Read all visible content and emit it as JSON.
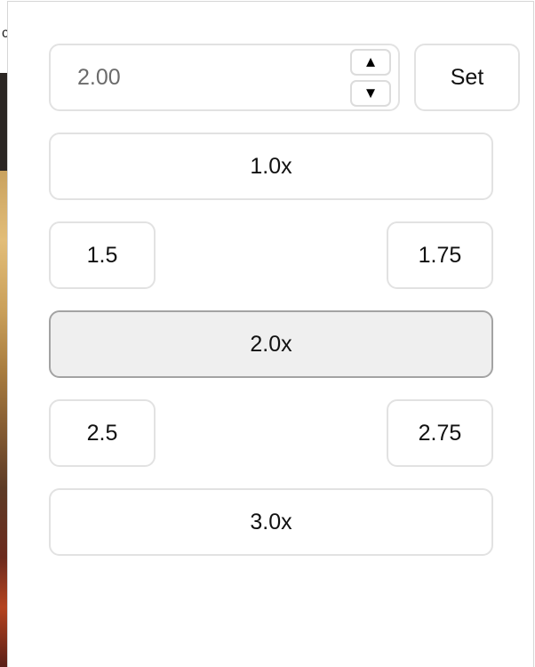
{
  "background": {
    "partial_letter": "c"
  },
  "speed_input": {
    "value": "2.00",
    "up_glyph": "▲",
    "down_glyph": "▼"
  },
  "set_button": {
    "label": "Set"
  },
  "presets": {
    "p1_0": "1.0x",
    "p1_5": "1.5",
    "p1_75": "1.75",
    "p2_0": "2.0x",
    "p2_5": "2.5",
    "p2_75": "2.75",
    "p3_0": "3.0x"
  },
  "active_preset": "2.0x",
  "colors": {
    "active_bg": "#efefef",
    "active_border": "#a3a3a3",
    "button_border": "#e2e2e2"
  }
}
